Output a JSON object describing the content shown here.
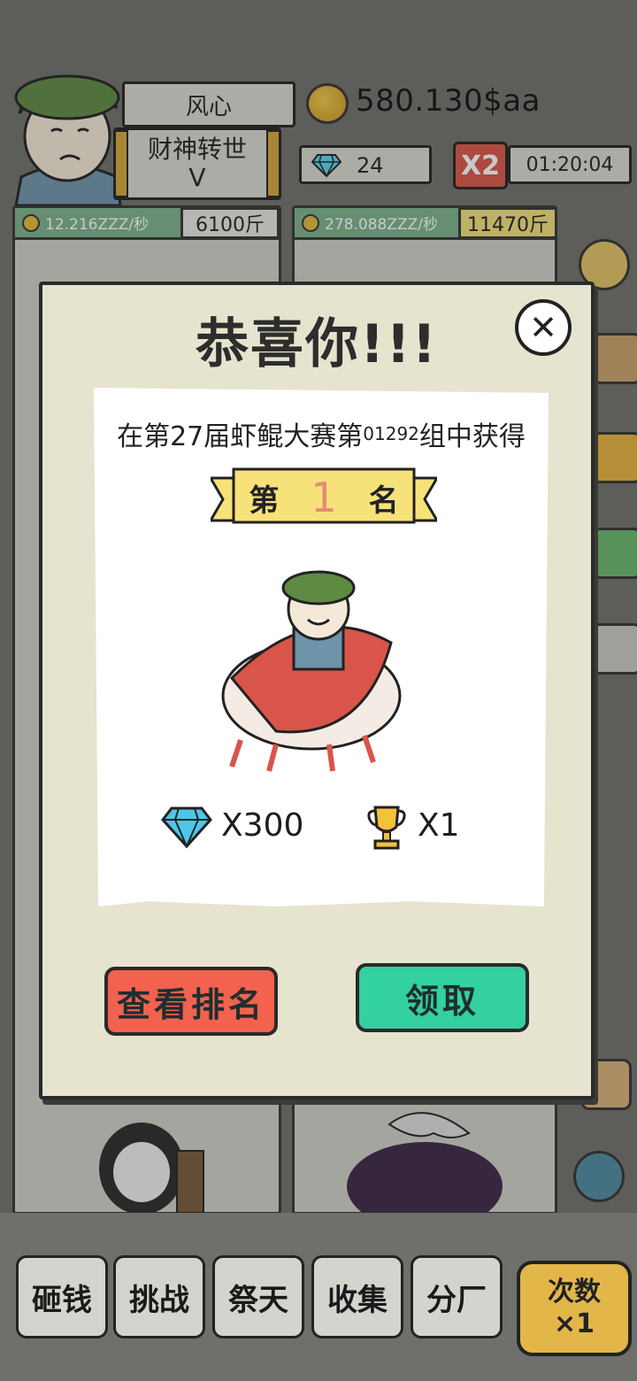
{
  "player": {
    "name": "风心",
    "title_line1": "财神转世",
    "title_line2": "V"
  },
  "currency": {
    "coins": "580.130$aa",
    "gems": "24",
    "multiplier": "X2",
    "timer": "01:20:04"
  },
  "slots": [
    {
      "rate": "12.216ZZZ/秒",
      "weight": "6100斤"
    },
    {
      "rate": "278.088ZZZ/秒",
      "weight": "11470斤"
    }
  ],
  "modal": {
    "title": "恭喜你!!!",
    "close_label": "✕",
    "award_prefix": "在第27届虾鲲大赛第",
    "award_group": "01292",
    "award_suffix": "组中获得",
    "rank_prefix": "第",
    "rank_value": "1",
    "rank_suffix": "名",
    "reward_gems": "X300",
    "reward_trophy": "X1",
    "view_rank_label": "查看排名",
    "claim_label": "领取"
  },
  "bottom_nav": {
    "items": [
      "砸钱",
      "挑战",
      "祭天",
      "收集",
      "分厂"
    ],
    "special_line1": "次数",
    "special_line2": "×1"
  },
  "colors": {
    "view_rank_button": "#f2624e",
    "claim_button": "#33d0a0",
    "ribbon": "#f7e27a",
    "rank_number": "#e48a7a"
  }
}
